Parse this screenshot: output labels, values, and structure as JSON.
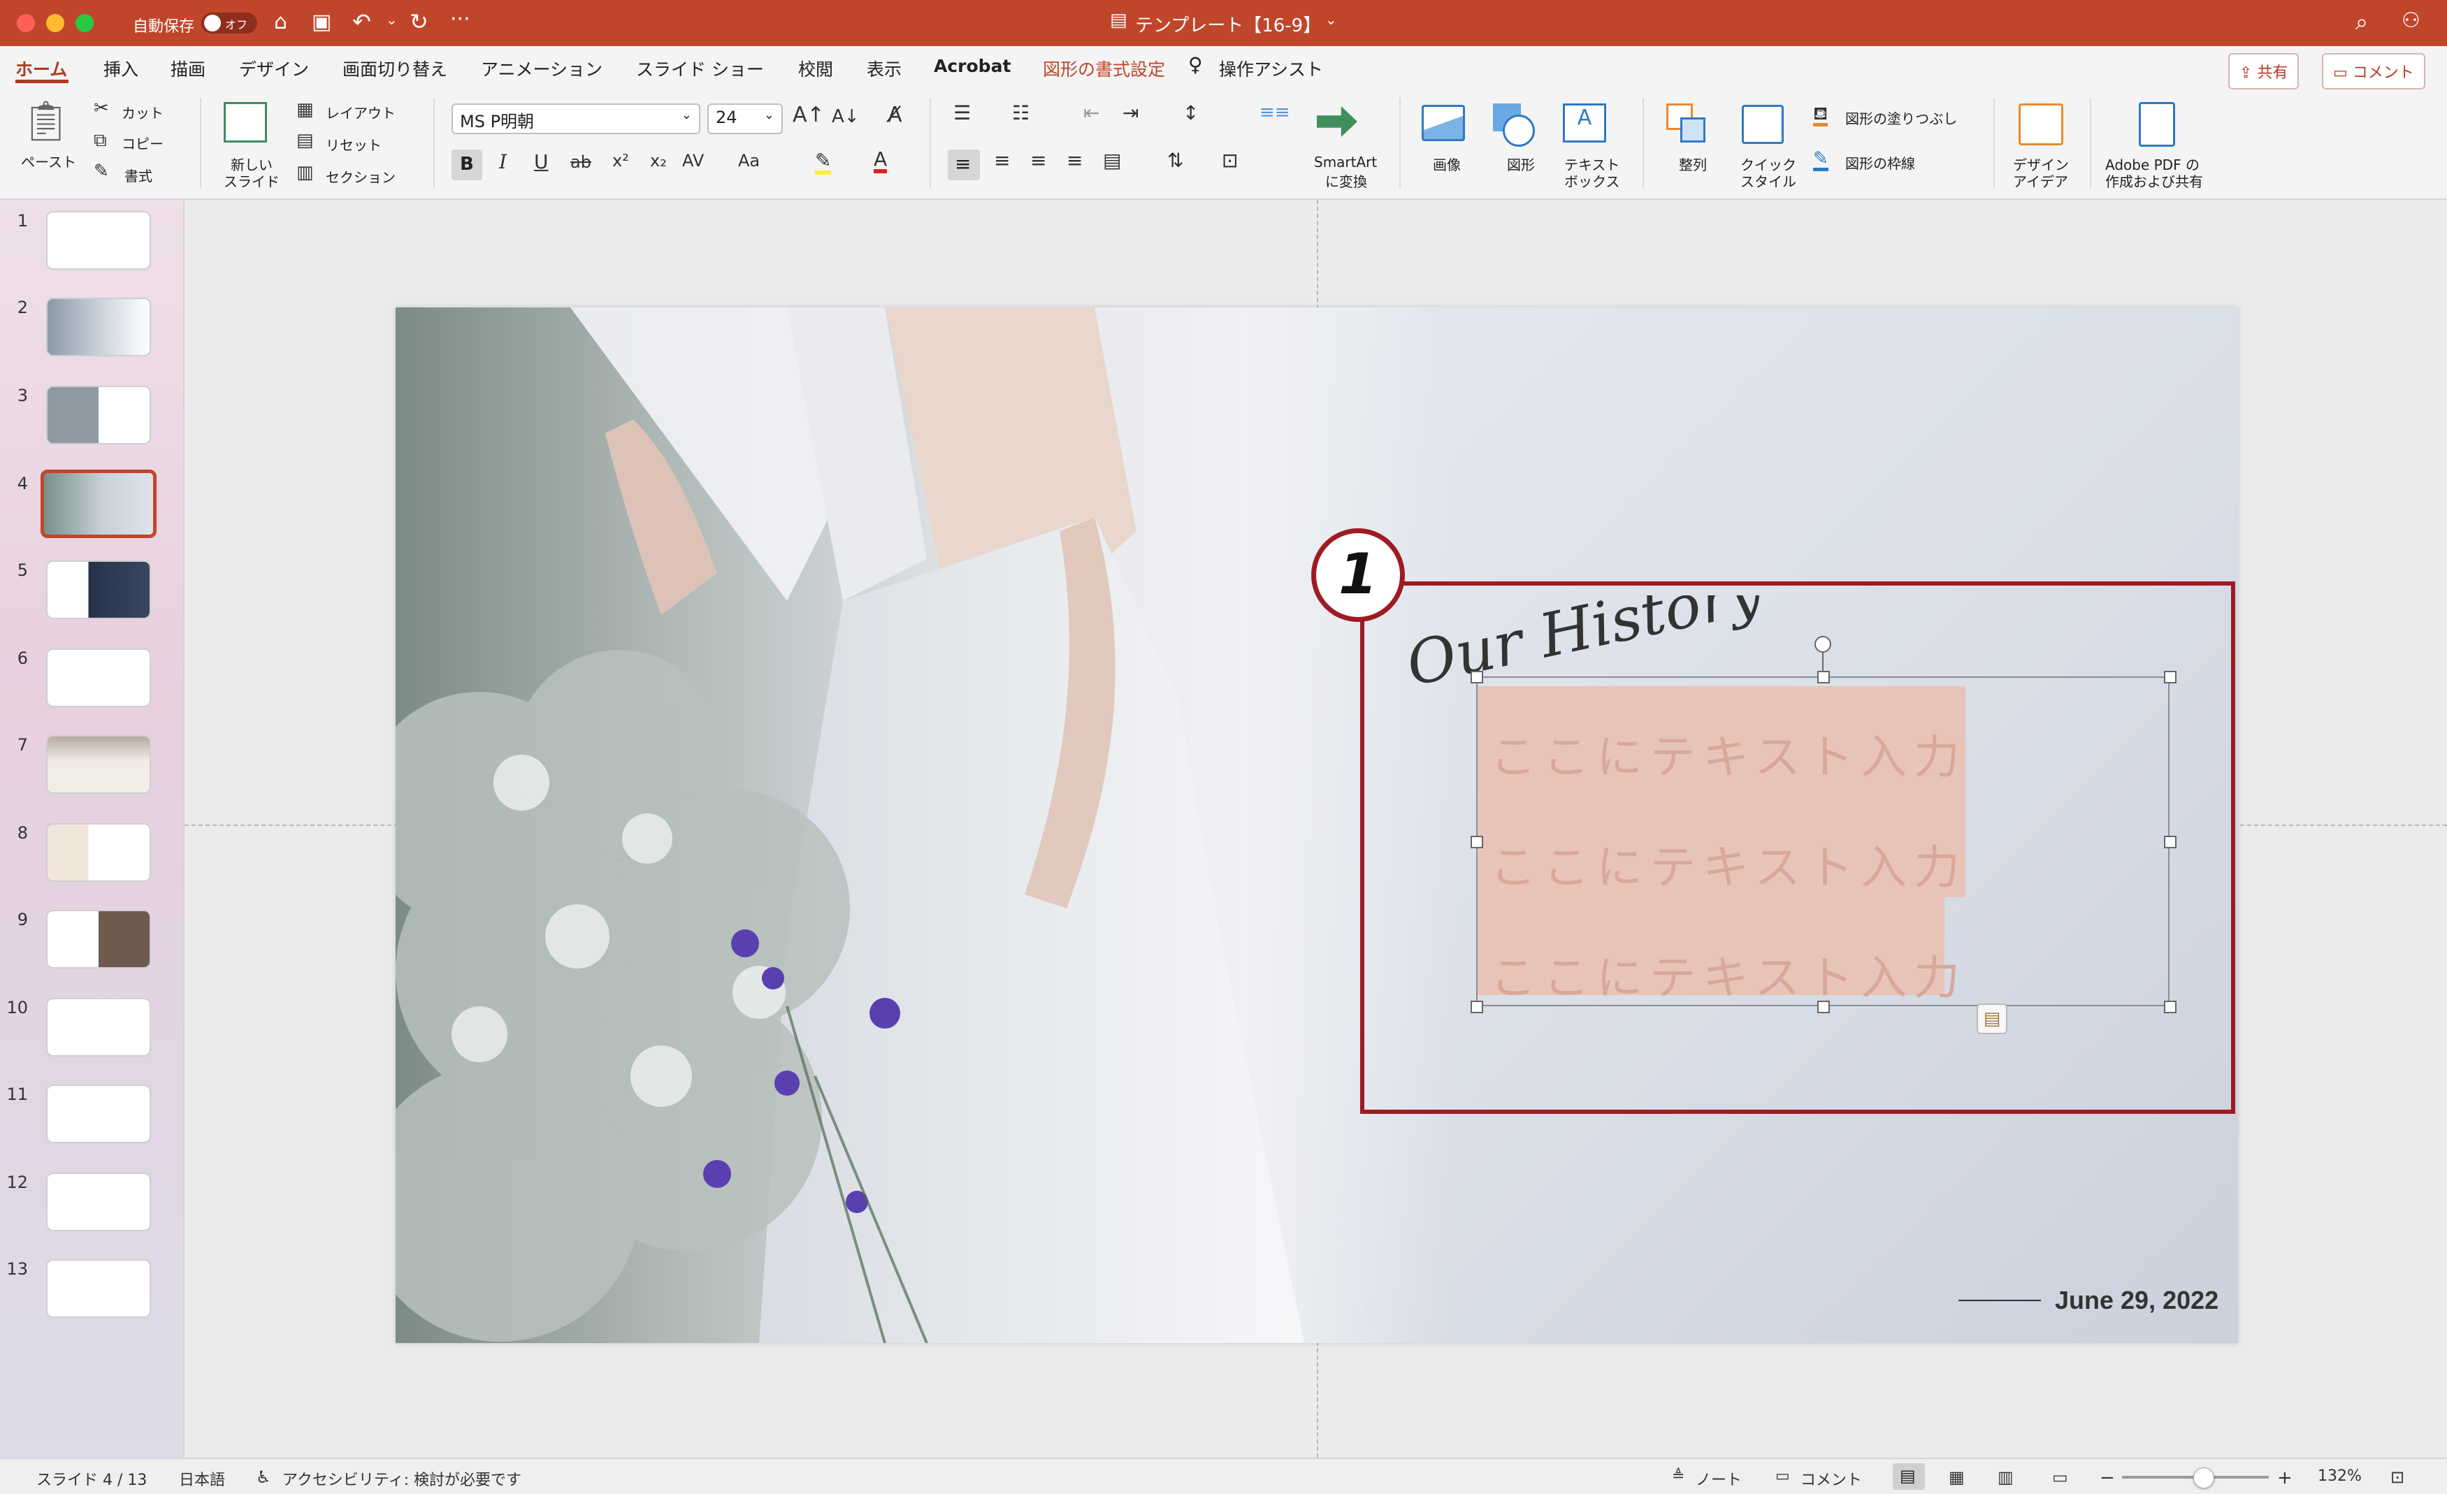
{
  "titlebar": {
    "autosave_label": "自動保存",
    "autosave_state": "オフ",
    "document_title": "テンプレート【16-9】"
  },
  "tabs": [
    {
      "label": "ホーム"
    },
    {
      "label": "挿入"
    },
    {
      "label": "描画"
    },
    {
      "label": "デザイン"
    },
    {
      "label": "画面切り替え"
    },
    {
      "label": "アニメーション"
    },
    {
      "label": "スライド ショー"
    },
    {
      "label": "校閲"
    },
    {
      "label": "表示"
    },
    {
      "label": "Acrobat"
    },
    {
      "label": "図形の書式設定"
    },
    {
      "label": "操作アシスト"
    }
  ],
  "share": {
    "share_label": "共有",
    "comment_label": "コメント"
  },
  "ribbon": {
    "paste": "ペースト",
    "cut": "カット",
    "copy": "コピー",
    "format": "書式",
    "new_slide_1": "新しい",
    "new_slide_2": "スライド",
    "layout": "レイアウト",
    "reset": "リセット",
    "section": "セクション",
    "font_name": "MS P明朝",
    "font_size": "24",
    "smartart_1": "SmartArt",
    "smartart_2": "に変換",
    "picture": "画像",
    "shape": "図形",
    "textbox_1": "テキスト",
    "textbox_2": "ボックス",
    "arrange": "整列",
    "quickstyle_1": "クイック",
    "quickstyle_2": "スタイル",
    "shape_fill": "図形の塗りつぶし",
    "shape_outline": "図形の枠線",
    "designer_1": "デザイン",
    "designer_2": "アイデア",
    "adobe_1": "Adobe PDF の",
    "adobe_2": "作成および共有"
  },
  "thumbnails": [
    "1",
    "2",
    "3",
    "4",
    "5",
    "6",
    "7",
    "8",
    "9",
    "10",
    "11",
    "12",
    "13"
  ],
  "slide": {
    "heading": "Our History",
    "callout": "1",
    "lines": [
      "ここにテキスト入力",
      "ここにテキスト入力",
      "ここにテキスト入力"
    ],
    "date": "June 29, 2022"
  },
  "status": {
    "slide_pos": "スライド 4 / 13",
    "language": "日本語",
    "accessibility": "アクセシビリティ: 検討が必要です",
    "notes": "ノート",
    "comments": "コメント",
    "zoom": "132%"
  },
  "colors": {
    "accent": "#c0462b",
    "callout": "#9e1b23",
    "text_highlight": "#e8c4b8"
  }
}
